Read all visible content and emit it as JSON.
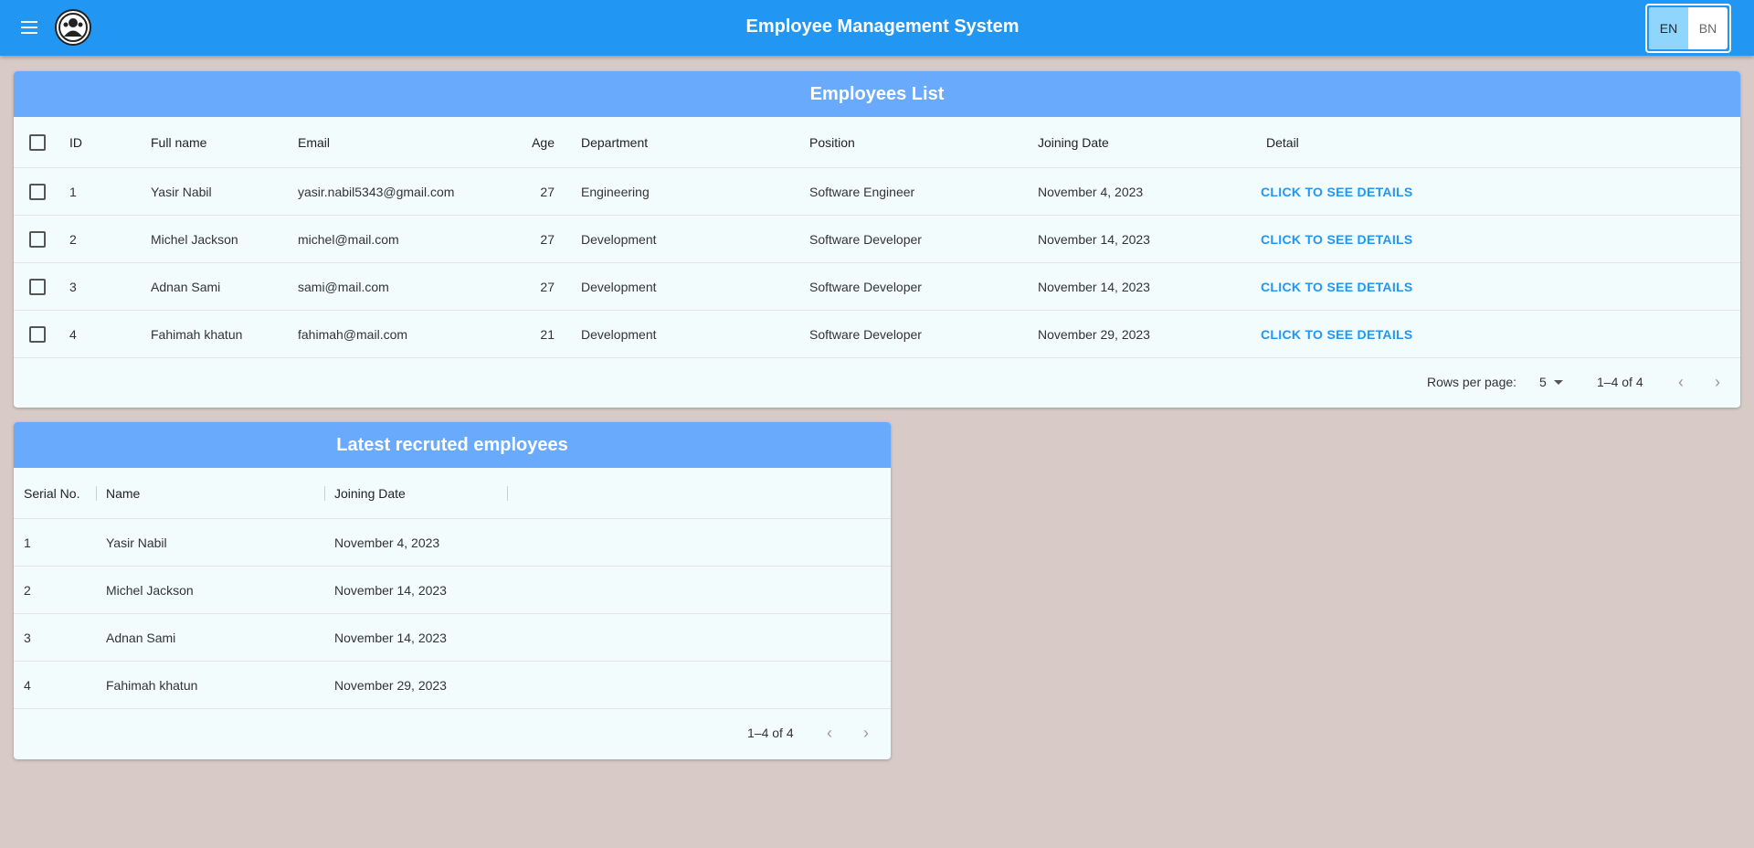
{
  "header": {
    "title": "Employee Management System",
    "menu_icon": "menu-icon",
    "logo_icon": "company-logo",
    "languages": [
      "EN",
      "BN"
    ],
    "active_language": "EN"
  },
  "employees_card": {
    "title": "Employees List",
    "columns": [
      "ID",
      "Full name",
      "Email",
      "Age",
      "Department",
      "Position",
      "Joining Date",
      "Detail"
    ],
    "rows": [
      {
        "id": "1",
        "name": "Yasir Nabil",
        "email": "yasir.nabil5343@gmail.com",
        "age": "27",
        "department": "Engineering",
        "position": "Software Engineer",
        "joining": "November 4, 2023",
        "detail": "CLICK TO SEE DETAILS"
      },
      {
        "id": "2",
        "name": "Michel Jackson",
        "email": "michel@mail.com",
        "age": "27",
        "department": "Development",
        "position": "Software Developer",
        "joining": "November 14, 2023",
        "detail": "CLICK TO SEE DETAILS"
      },
      {
        "id": "3",
        "name": "Adnan Sami",
        "email": "sami@mail.com",
        "age": "27",
        "department": "Development",
        "position": "Software Developer",
        "joining": "November 14, 2023",
        "detail": "CLICK TO SEE DETAILS"
      },
      {
        "id": "4",
        "name": "Fahimah khatun",
        "email": "fahimah@mail.com",
        "age": "21",
        "department": "Development",
        "position": "Software Developer",
        "joining": "November 29, 2023",
        "detail": "CLICK TO SEE DETAILS"
      }
    ],
    "footer": {
      "rows_per_page_label": "Rows per page:",
      "rows_per_page_value": "5",
      "range": "1–4 of 4"
    }
  },
  "recruited_card": {
    "title": "Latest recruted employees",
    "columns": [
      "Serial No.",
      "Name",
      "Joining Date"
    ],
    "rows": [
      {
        "serial": "1",
        "name": "Yasir Nabil",
        "joining": "November 4, 2023"
      },
      {
        "serial": "2",
        "name": "Michel Jackson",
        "joining": "November 14, 2023"
      },
      {
        "serial": "3",
        "name": "Adnan Sami",
        "joining": "November 14, 2023"
      },
      {
        "serial": "4",
        "name": "Fahimah khatun",
        "joining": "November 29, 2023"
      }
    ],
    "footer": {
      "range": "1–4 of 4"
    }
  },
  "colors": {
    "appbar": "#2196f3",
    "card_header": "#6aaafc",
    "background": "#d7cac7",
    "card_body": "#f3fcfd",
    "link": "#2196f3"
  }
}
